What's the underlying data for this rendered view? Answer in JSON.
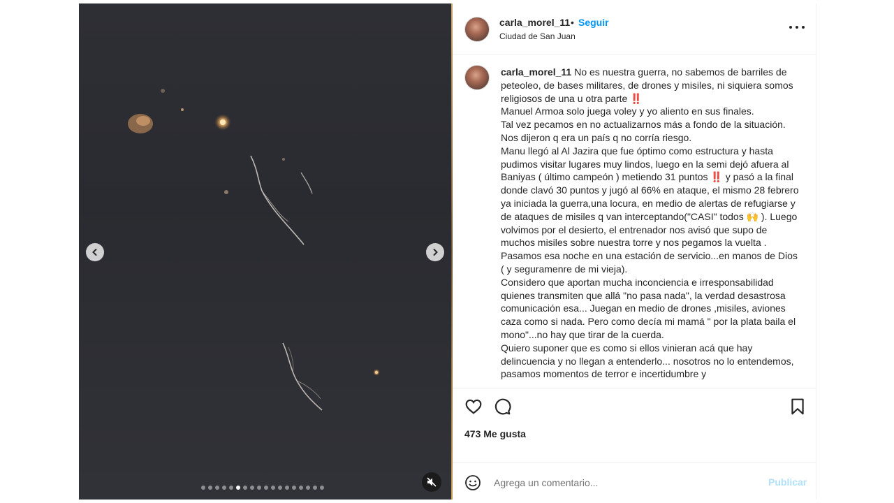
{
  "media": {
    "prev_icon": "chevron-left-icon",
    "next_icon": "chevron-right-icon",
    "mute_icon": "speaker-muted-icon",
    "carousel_total": 18,
    "carousel_active_index": 5
  },
  "post": {
    "username": "carla_morel_11",
    "separator": "•",
    "follow_label": "Seguir",
    "location": "Ciudad de San Juan",
    "more_icon": "more-horizontal-icon"
  },
  "caption": {
    "username": "carla_morel_11",
    "lines": [
      "No es nuestra guerra, no sabemos de barriles de peteoleo, de bases militares, de drones y misiles, ni siquiera somos religiosos de una u otra parte ‼️",
      "Manuel Armoa  solo juega voley y yo aliento en sus finales.",
      "Tal vez pecamos en no actualizarnos más a fondo de la situación.",
      "Nos dijeron q era un país q no corría riesgo.",
      "Manu llegó al Al Jazira que fue óptimo como estructura y hasta pudimos visitar lugares muy lindos, luego en la semi dejó afuera al Baniyas ( último campeón ) metiendo 31 puntos ‼️  y pasó a la final donde clavó 30 puntos y jugó al 66% en ataque, el mismo 28 febrero ya iniciada la guerra,una locura, en medio de alertas de refugiarse y de ataques de misiles q van interceptando(\"CASI\" todos 🙌 ). Luego volvimos por el desierto, el entrenador nos avisó que supo  de muchos misiles sobre nuestra torre y nos pegamos la vuelta . Pasamos esa noche en una estación de servicio...en manos de Dios ( y seguramenre de mi vieja).",
      "Considero que aportan mucha inconciencia e irresponsabilidad quienes transmiten que allá \"no pasa nada\",  la verdad desastrosa comunicación esa... Juegan en medio de drones ,misiles, aviones caza como si nada. Pero como decía mi mamá \" por la plata baila el mono\"...no hay que tirar de la cuerda.",
      "Quiero suponer que es como si ellos vinieran acá que hay delincuencia y no llegan a entenderlo... nosotros no lo entendemos, pasamos momentos de terror e incertidumbre y"
    ]
  },
  "actions": {
    "like_icon": "heart-icon",
    "comment_icon": "comment-bubble-icon",
    "save_icon": "bookmark-icon",
    "likes_text": "473 Me gusta"
  },
  "comment_box": {
    "emoji_icon": "smiley-icon",
    "placeholder": "Agrega un comentario...",
    "publish_label": "Publicar",
    "publish_color": "#b2dffc"
  }
}
